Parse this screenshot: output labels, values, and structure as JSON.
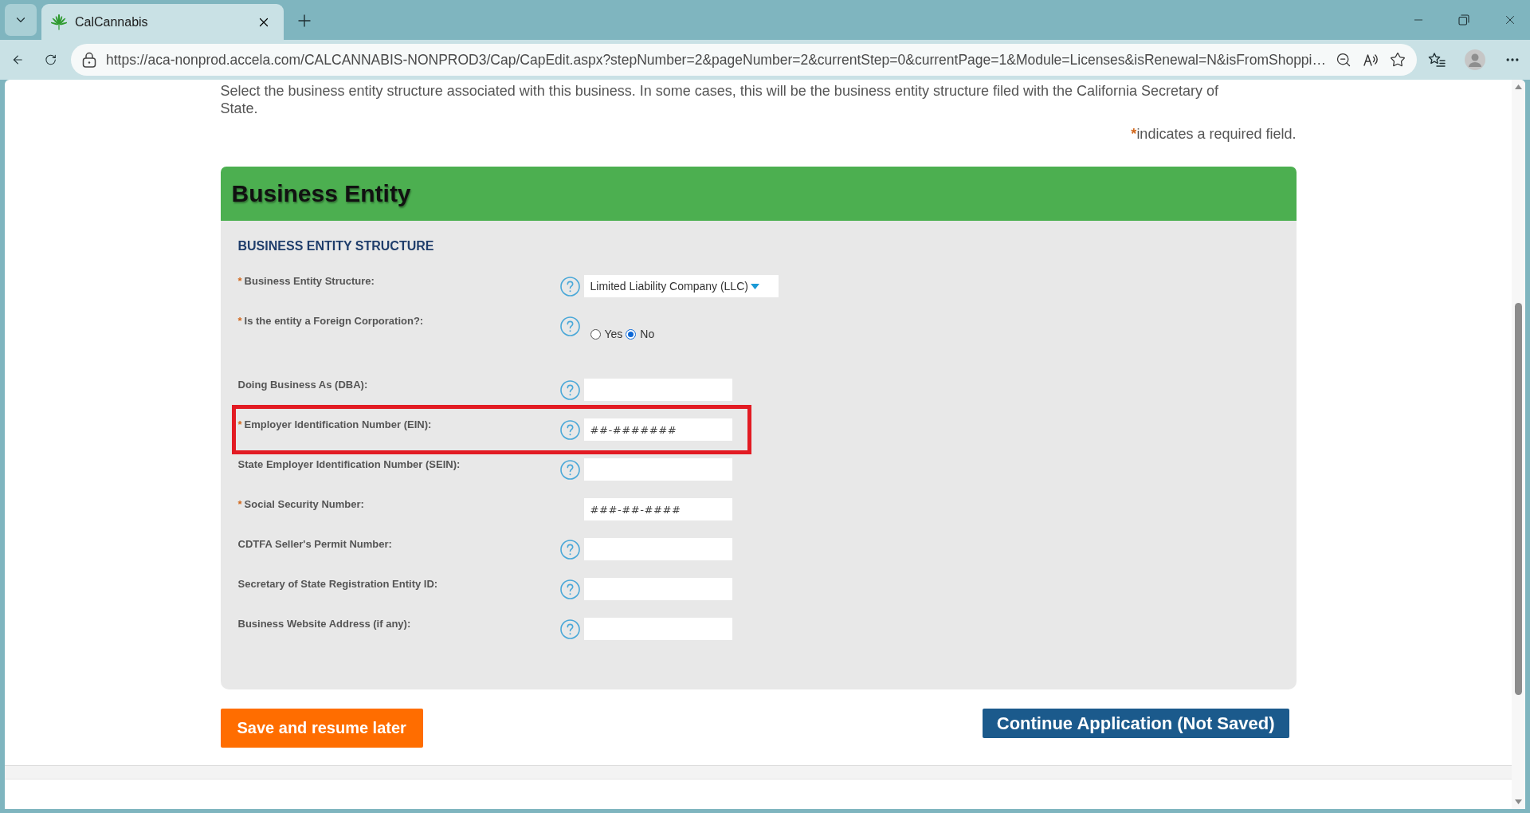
{
  "browser": {
    "tabs": [
      {
        "title": "CalCannabis",
        "selected": true
      }
    ],
    "address_bar": {
      "url": "https://aca-nonprod.accela.com/CALCANNABIS-NONPROD3/Cap/CapEdit.aspx?stepNumber=2&pageNumber=2&currentStep=0&currentPage=1&Module=Licenses&isRenewal=N&isFromShoppi…"
    }
  },
  "page": {
    "intro": "Select the business entity structure associated with this business. In some cases, this will be the business entity structure filed with the California Secretary of State.",
    "required_note": {
      "mark": "*",
      "text": "indicates a required field."
    },
    "section": {
      "title": "Business Entity",
      "subtitle": "BUSINESS ENTITY STRUCTURE",
      "fields": [
        {
          "kind": "select",
          "required_mark": "*",
          "label": "Business Entity Structure:",
          "help": true,
          "highlighted": false,
          "value": "Limited Liability Company (LLC)"
        },
        {
          "kind": "radio",
          "required_mark": "*",
          "label": "Is the entity a Foreign Corporation?:",
          "help": true,
          "highlighted": false,
          "options": [
            {
              "label": "Yes",
              "selected": false
            },
            {
              "label": "No",
              "selected": true
            }
          ]
        },
        {
          "kind": "text",
          "label": "Doing Business As (DBA):",
          "help": true,
          "highlighted": false
        },
        {
          "kind": "text",
          "required_mark": "*",
          "label": "Employer Identification Number (EIN):",
          "help": true,
          "highlighted": true,
          "placeholder": "##-#######"
        },
        {
          "kind": "text",
          "label": "State Employer Identification Number (SEIN):",
          "help": true,
          "highlighted": false
        },
        {
          "kind": "text",
          "required_mark": "*",
          "label": "Social Security Number:",
          "help": false,
          "highlighted": false,
          "placeholder": "###-##-####"
        },
        {
          "kind": "text",
          "label": "CDTFA Seller's Permit Number:",
          "help": true,
          "highlighted": false
        },
        {
          "kind": "text",
          "label": "Secretary of State Registration Entity ID:",
          "help": true,
          "highlighted": false
        },
        {
          "kind": "text",
          "label": "Business Website Address (if any):",
          "help": true,
          "highlighted": false
        }
      ]
    },
    "buttons": [
      {
        "kind": "save",
        "label": "Save and resume later"
      },
      {
        "kind": "continue",
        "label": "Continue Application (Not Saved)"
      }
    ]
  }
}
